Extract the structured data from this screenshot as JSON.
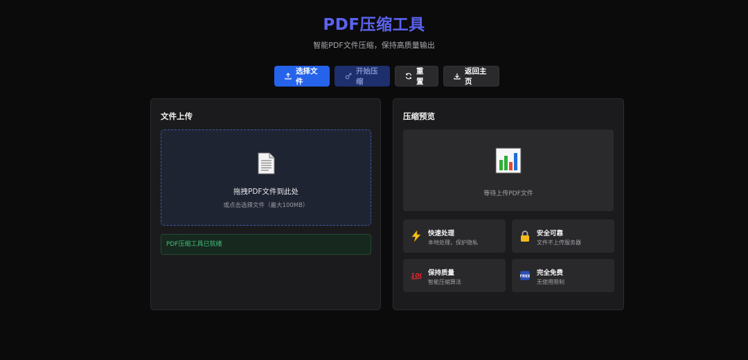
{
  "header": {
    "title": "PDF压缩工具",
    "subtitle": "智能PDF文件压缩，保持高质量输出"
  },
  "toolbar": {
    "select_label": "选择文件",
    "compress_label": "开始压缩",
    "reset_label": "重置",
    "home_label": "返回主页"
  },
  "upload_panel": {
    "title": "文件上传",
    "drop_main": "拖拽PDF文件到此处",
    "drop_sub": "或点击选择文件（最大100MB）",
    "status": "PDF压缩工具已就绪"
  },
  "preview_panel": {
    "title": "压缩预览",
    "waiting_text": "等待上传PDF文件",
    "features": [
      {
        "icon": "lightning-icon",
        "title": "快速处理",
        "desc": "本地处理，保护隐私"
      },
      {
        "icon": "lock-icon",
        "title": "安全可靠",
        "desc": "文件不上传服务器"
      },
      {
        "icon": "hundred-icon",
        "title": "保持质量",
        "desc": "智能压缩算法"
      },
      {
        "icon": "free-icon",
        "title": "完全免费",
        "desc": "无使用限制"
      }
    ]
  },
  "colors": {
    "accent": "#5b63f0",
    "primary_button": "#2563eb",
    "status_green": "#3fbf7a"
  }
}
